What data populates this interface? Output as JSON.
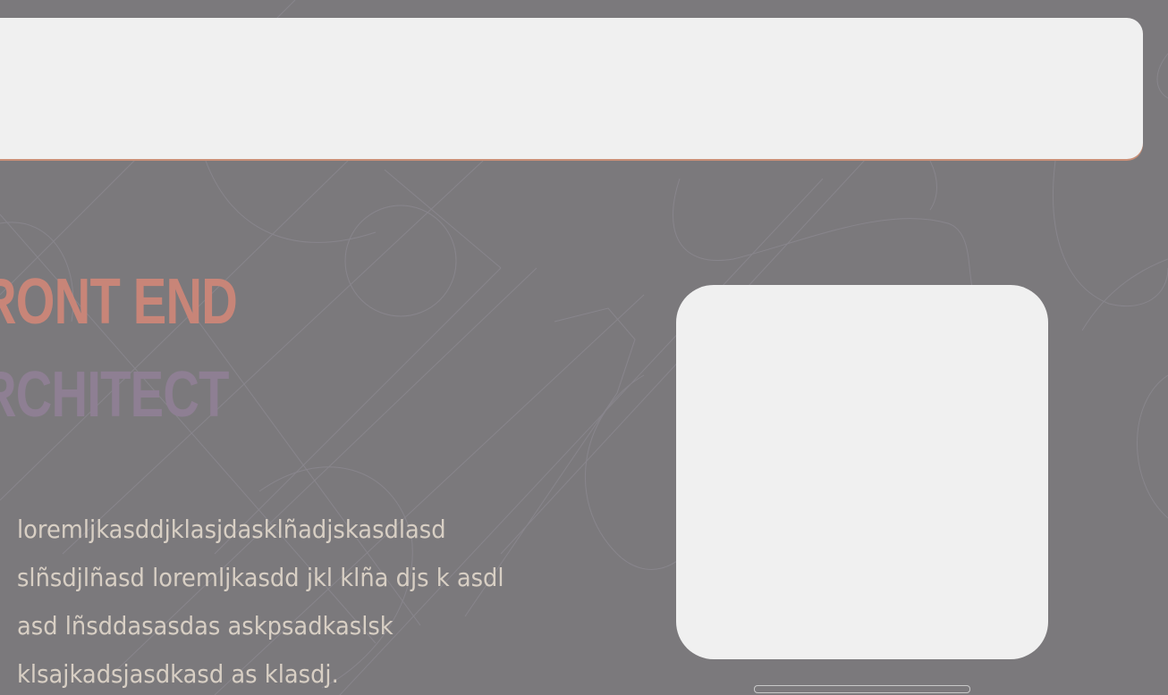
{
  "hero": {
    "line1": "RONT END",
    "line2": "RCHITECT"
  },
  "body": {
    "paragraph": "loremljkasddjklasjdasklñadjskasdlasd slñsdjlñasd loremljkasdd jkl klña djs k asdl asd lñsddasasdas askpsadkaslsk klsajkadsjasdkasd as klasdj."
  },
  "colors": {
    "background": "#7b797c",
    "card": "#f0f0f0",
    "title_top": "#c88578",
    "title_bottom": "#8e7f93",
    "body_text": "#d8cfc4"
  }
}
